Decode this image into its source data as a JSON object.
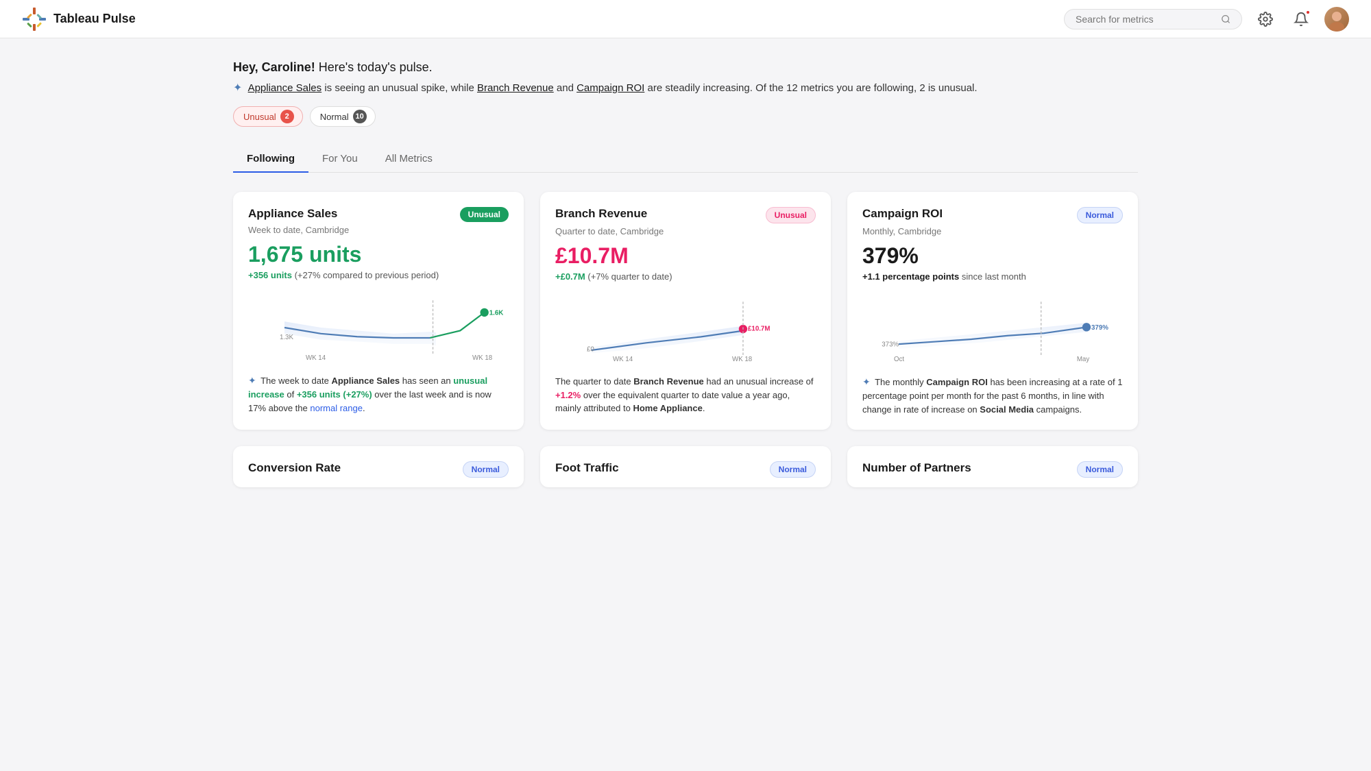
{
  "header": {
    "app_name": "Tableau Pulse",
    "search_placeholder": "Search for metrics"
  },
  "greeting": {
    "salutation": "Hey, Caroline!",
    "subtitle": "Here's today's pulse.",
    "description_prefix": "is seeing an unusual spike, while",
    "link1": "Appliance Sales",
    "link2": "Branch Revenue",
    "link3": "Campaign ROI",
    "description_mid": "and",
    "description_suffix": "are steadily increasing. Of the 12 metrics you are following, 2 is unusual."
  },
  "filters": {
    "unusual_label": "Unusual",
    "unusual_count": "2",
    "normal_label": "Normal",
    "normal_count": "10"
  },
  "tabs": [
    {
      "label": "Following",
      "active": true
    },
    {
      "label": "For You",
      "active": false
    },
    {
      "label": "All Metrics",
      "active": false
    }
  ],
  "cards": [
    {
      "title": "Appliance Sales",
      "subtitle": "Week to date, Cambridge",
      "badge": "Unusual",
      "badge_type": "unusual_green",
      "value": "1,675 units",
      "value_type": "green",
      "change_highlight": "+356 units",
      "change_text": "(+27% compared to previous period)",
      "chart_type": "appliance",
      "desc_ai": true,
      "desc": "The week to date Appliance Sales has seen an unusual increase of +356 units (+27%) over the last week and is now 17% above the normal range.",
      "desc_highlight1": "unusual increase",
      "desc_highlight2": "+356 units (+27%)",
      "desc_link": "normal range"
    },
    {
      "title": "Branch Revenue",
      "subtitle": "Quarter to date, Cambridge",
      "badge": "Unusual",
      "badge_type": "unusual_pink",
      "value": "£10.7M",
      "value_type": "pink",
      "change_highlight": "+£0.7M",
      "change_text": "(+7% quarter to date)",
      "chart_type": "branch",
      "desc_ai": false,
      "desc": "The quarter to date Branch Revenue had an unusual increase of +1.2% over the equivalent quarter to date value a year ago, mainly attributed to Home Appliance.",
      "desc_highlight1": "+1.2%",
      "desc_highlight2": "",
      "desc_link": ""
    },
    {
      "title": "Campaign ROI",
      "subtitle": "Monthly, Cambridge",
      "badge": "Normal",
      "badge_type": "normal",
      "value": "379%",
      "value_type": "dark",
      "change_highlight": "+1.1 percentage points",
      "change_text": "since last month",
      "chart_type": "campaign",
      "desc_ai": true,
      "desc": "The monthly Campaign ROI has been increasing at a rate of 1 percentage point per month for the past 6 months, in line with change in rate of increase on Social Media campaigns.",
      "desc_highlight1": "",
      "desc_highlight2": "",
      "desc_link": ""
    }
  ],
  "bottom_cards": [
    {
      "title": "Conversion Rate",
      "badge": "Normal"
    },
    {
      "title": "Foot Traffic",
      "badge": "Normal"
    },
    {
      "title": "Number of Partners",
      "badge": "Normal"
    }
  ]
}
